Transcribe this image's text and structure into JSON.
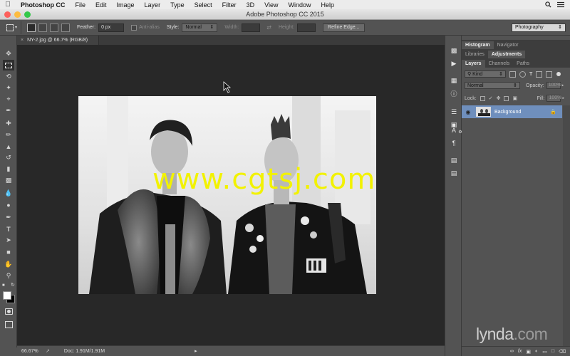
{
  "menubar": {
    "app_name": "Photoshop CC",
    "items": [
      "File",
      "Edit",
      "Image",
      "Layer",
      "Type",
      "Select",
      "Filter",
      "3D",
      "View",
      "Window",
      "Help"
    ]
  },
  "titlebar": {
    "title": "Adobe Photoshop CC 2015"
  },
  "options": {
    "feather_label": "Feather:",
    "feather_value": "0 px",
    "antialias_label": "Anti-alias",
    "style_label": "Style:",
    "style_value": "Normal",
    "width_label": "Width:",
    "height_label": "Height:",
    "refine_edge": "Refine Edge...",
    "workspace": "Photography"
  },
  "document": {
    "tab_title": "NY-2.jpg @ 66.7% (RGB/8)",
    "overlay_text": "www.cgtsj.com"
  },
  "status": {
    "zoom": "66.67%",
    "doc_info": "Doc: 1.91M/1.91M"
  },
  "panels": {
    "group1_tabs": [
      "Histogram",
      "Navigator"
    ],
    "group2_tabs": [
      "Libraries",
      "Adjustments"
    ],
    "group3_tabs": [
      "Layers",
      "Channels",
      "Paths"
    ],
    "kind_label": "Kind",
    "blend_mode": "Normal",
    "opacity_label": "Opacity:",
    "opacity_value": "100%",
    "lock_label": "Lock:",
    "fill_label": "Fill:",
    "fill_value": "100%",
    "layer_name": "Background"
  },
  "watermark": {
    "brand": "lynda",
    "suffix": ".com"
  },
  "colors": {
    "menubar_bg": "#ececec",
    "panel_bg": "#535353",
    "canvas_bg": "#282828",
    "layer_selected": "#6f8fbd",
    "overlay_text": "#f2f200"
  }
}
